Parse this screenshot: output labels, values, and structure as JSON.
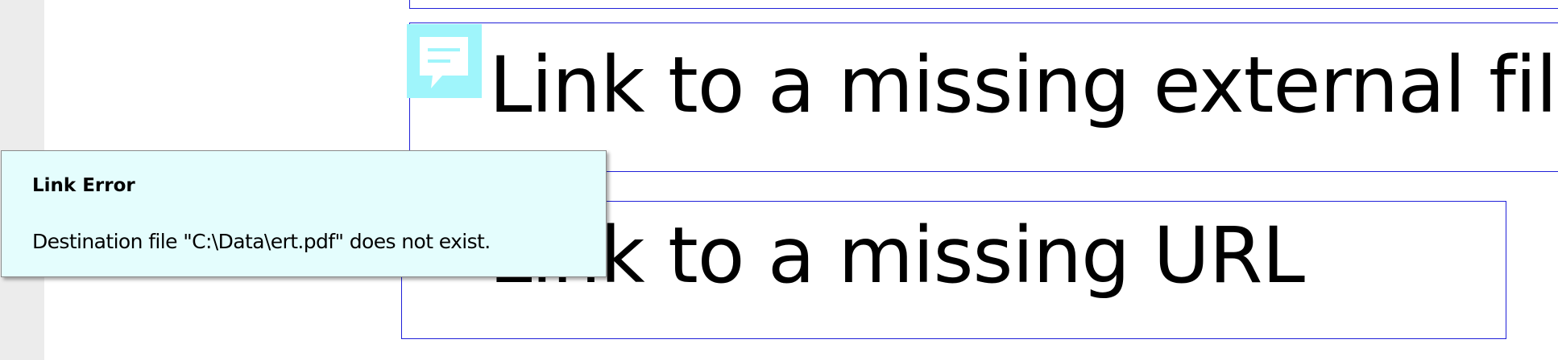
{
  "document": {
    "links": [
      {
        "label": ""
      },
      {
        "label": "Link to a missing external file"
      },
      {
        "label": "Link to a missing URL"
      }
    ],
    "comment_icon": {
      "icon": "comment-icon",
      "color": "#9ff5fb"
    },
    "link_border_color": "#2020d8"
  },
  "tooltip": {
    "title": "Link Error",
    "message": "Destination file \"C:\\Data\\ert.pdf\" does not exist.",
    "background": "#e4fdfd"
  },
  "colors": {
    "gutter": "#ececec",
    "page": "#ffffff"
  }
}
